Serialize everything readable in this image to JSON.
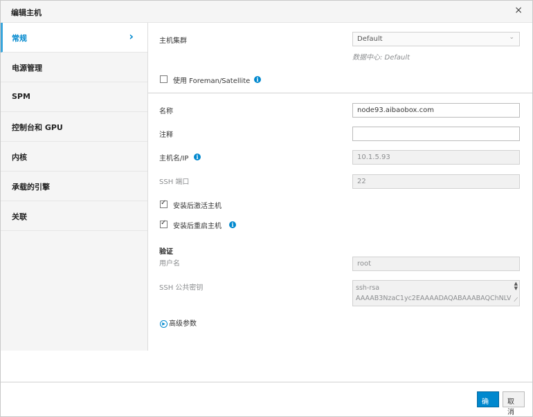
{
  "dialog": {
    "title": "编辑主机",
    "close_glyph": "×"
  },
  "sidebar": {
    "items": [
      {
        "label": "常规",
        "active": true
      },
      {
        "label": "电源管理"
      },
      {
        "label": "SPM"
      },
      {
        "label": "控制台和 GPU"
      },
      {
        "label": "内核"
      },
      {
        "label": "承载的引擎"
      },
      {
        "label": "关联"
      }
    ],
    "active_chevron": "›"
  },
  "general": {
    "cluster_label": "主机集群",
    "cluster_value": "Default",
    "datacenter_note": "数据中心: Default",
    "foreman_label": "使用 Foreman/Satellite",
    "name_label": "名称",
    "name_value": "node93.aibaobox.com",
    "comment_label": "注释",
    "comment_value": "",
    "hostname_label": "主机名/IP",
    "hostname_value": "10.1.5.93",
    "ssh_port_label": "SSH 端口",
    "ssh_port_value": "22",
    "activate_label": "安装后激活主机",
    "reboot_label": "安装后重启主机",
    "auth_section": "验证",
    "username_label": "用户名",
    "username_value": "root",
    "ssh_key_label": "SSH 公共密钥",
    "ssh_key_line1": "ssh-rsa",
    "ssh_key_line2": "AAAAB3NzaC1yc2EAAAADAQABAAABAQChNLV",
    "advanced_label": "高级参数"
  },
  "footer": {
    "ok_label": "确定",
    "cancel_label": "取消"
  },
  "colors": {
    "accent": "#0088ce",
    "active_border": "#39a5dc"
  },
  "icons": {
    "info": "info-icon",
    "close": "close-icon",
    "chevron": "chevron-right-icon",
    "expand": "expand-arrow-icon"
  }
}
